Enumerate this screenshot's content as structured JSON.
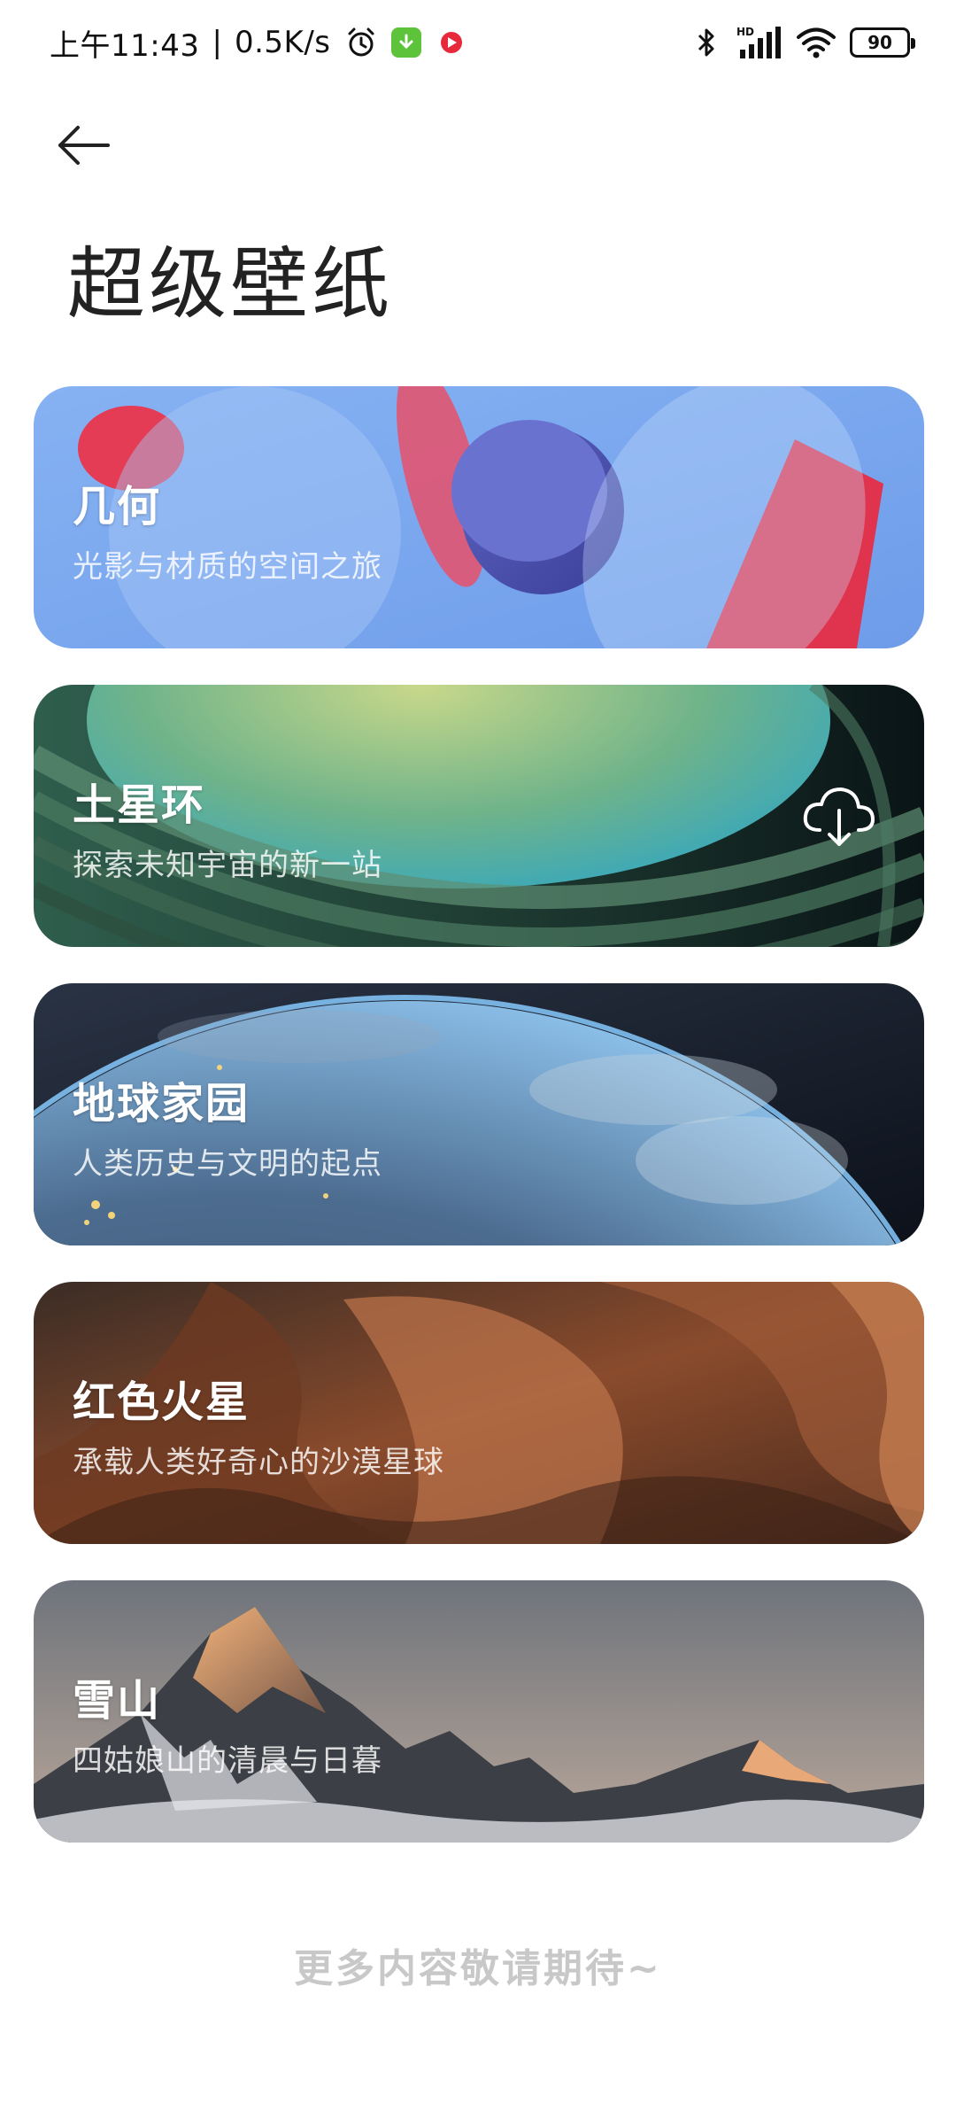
{
  "status_bar": {
    "time": "上午11:43",
    "separator": "|",
    "speed": "0.5K/s",
    "battery": "90",
    "icons": [
      "alarm-icon",
      "download-app-icon",
      "record-app-icon",
      "bluetooth-icon",
      "hd-signal-icon",
      "wifi-icon",
      "battery-icon"
    ]
  },
  "header": {
    "back_icon": "arrow-left-icon",
    "title": "超级壁纸"
  },
  "cards": [
    {
      "title": "几何",
      "subtitle": "光影与材质的空间之旅"
    },
    {
      "title": "土星环",
      "subtitle": "探索未知宇宙的新一站",
      "action_icon": "cloud-download-icon"
    },
    {
      "title": "地球家园",
      "subtitle": "人类历史与文明的起点"
    },
    {
      "title": "红色火星",
      "subtitle": "承载人类好奇心的沙漠星球"
    },
    {
      "title": "雪山",
      "subtitle": "四姑娘山的清晨与日暮"
    }
  ],
  "footer": {
    "note": "更多内容敬请期待~"
  },
  "colors": {
    "geometry_bg": "#7aa6ef",
    "saturn_bg": "#1d3f36",
    "earth_bg": "#1a2230",
    "mars_bg": "#6b3b26",
    "snow_bg": "#7a7d82"
  }
}
